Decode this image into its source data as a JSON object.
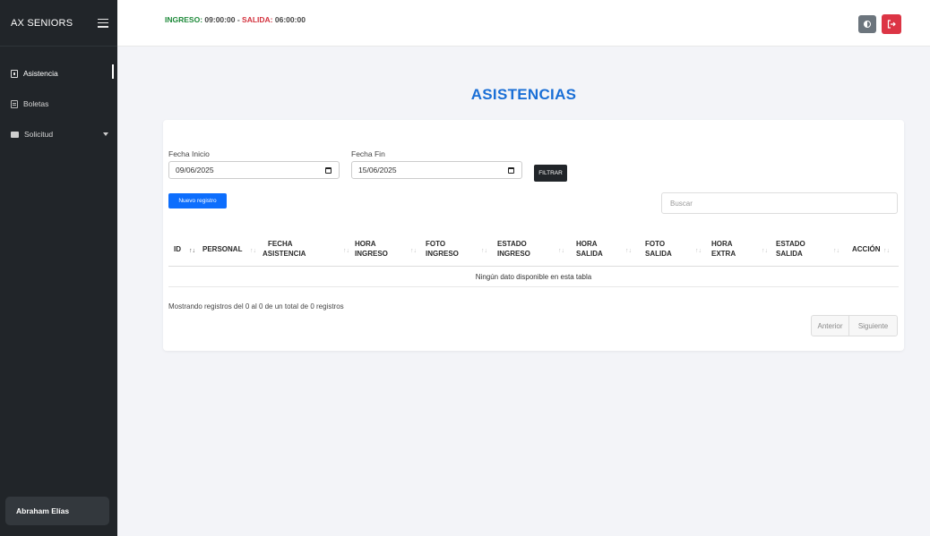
{
  "sidebar": {
    "brand": "AX SENIORS",
    "items": [
      {
        "label": "Asistencia",
        "icon": "id-badge-icon"
      },
      {
        "label": "Boletas",
        "icon": "document-icon"
      },
      {
        "label": "Solicitud",
        "icon": "folder-icon"
      }
    ],
    "user": "Abraham Elías"
  },
  "topbar": {
    "ingreso_label": "INGRESO:",
    "ingreso_time": "09:00:00",
    "separator": "-",
    "salida_label": "SALIDA:",
    "salida_time": "06:00:00",
    "theme_icon": "contrast-icon",
    "logout_icon": "logout-icon"
  },
  "page": {
    "title": "ASISTENCIAS"
  },
  "filters": {
    "start_label": "Fecha Inicio",
    "start_value": "09/06/2025",
    "end_label": "Fecha Fin",
    "end_value": "15/06/2025",
    "filter_button": "FILTRAR"
  },
  "actions": {
    "new_button": "Nuevo registro",
    "search_placeholder": "Buscar"
  },
  "table": {
    "columns": [
      {
        "l1": "",
        "l2": "ID"
      },
      {
        "l1": "",
        "l2": "PERSONAL"
      },
      {
        "l1": "FECHA",
        "l2": "ASISTENCIA"
      },
      {
        "l1": "HORA",
        "l2": "INGRESO"
      },
      {
        "l1": "FOTO",
        "l2": "INGRESO"
      },
      {
        "l1": "ESTADO",
        "l2": "INGRESO"
      },
      {
        "l1": "HORA",
        "l2": "SALIDA"
      },
      {
        "l1": "FOTO",
        "l2": "SALIDA"
      },
      {
        "l1": "HORA",
        "l2": "EXTRA"
      },
      {
        "l1": "ESTADO",
        "l2": "SALIDA"
      },
      {
        "l1": "",
        "l2": "ACCIÓN"
      }
    ],
    "sort_icon": "↑↓",
    "empty_message": "Ningún dato disponible en esta tabla",
    "info": "Mostrando registros del 0 al 0 de un total de 0 registros",
    "prev": "Anterior",
    "next": "Siguiente"
  },
  "colors": {
    "sidebar": "#212529",
    "title": "#1a6fd6",
    "ingreso": "#1e8a3a",
    "salida": "#d3313d",
    "primary": "#0d6efd",
    "danger": "#dc3545"
  }
}
